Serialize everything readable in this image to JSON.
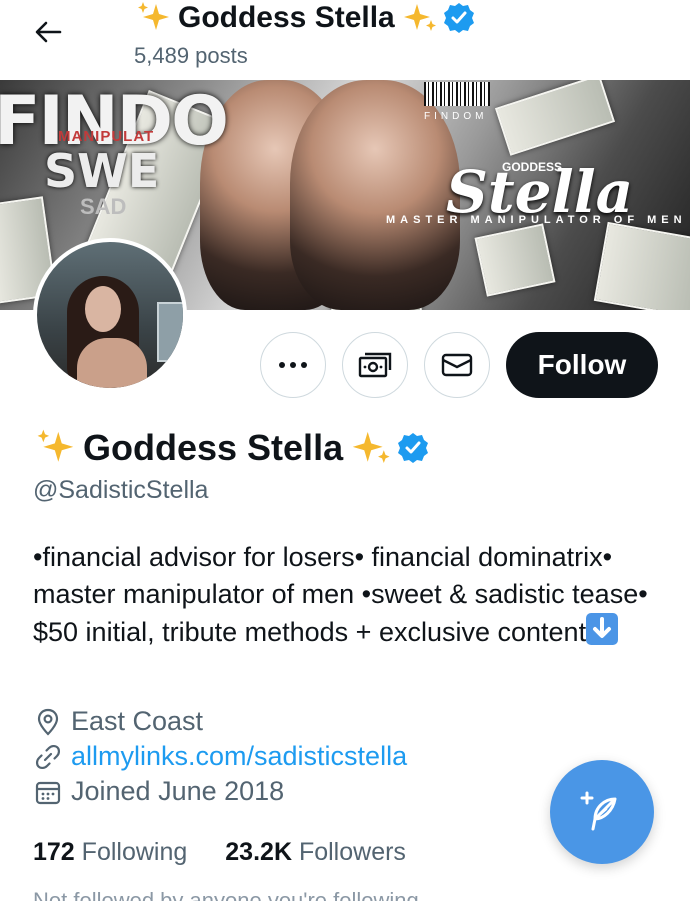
{
  "header": {
    "display_name": "Goddess Stella",
    "posts_count": "5,489 posts"
  },
  "banner": {
    "text_findo": "FINDO",
    "text_manipulat": "MANIPULAT",
    "text_swe": "SWE",
    "text_sad": "SAD",
    "text_findom": "FINDOM",
    "text_goddess": "GODDESS",
    "text_stella": "Stella",
    "text_tagline": "MASTER MANIPULATOR OF MEN"
  },
  "actions": {
    "follow_label": "Follow",
    "more_icon": "more-horizontal-icon",
    "tip_icon": "money-icon",
    "message_icon": "envelope-icon"
  },
  "profile": {
    "display_name": "Goddess Stella",
    "handle": "@SadisticStella",
    "bio": "•financial advisor for losers• financial dominatrix• master manipulator of men •sweet & sadistic tease• $50 initial, tribute methods + exclusive content",
    "location": "East Coast",
    "website": "allmylinks.com/sadisticstella",
    "joined": "Joined June 2018"
  },
  "stats": {
    "following_count": "172",
    "following_label": "Following",
    "followers_count": "23.2K",
    "followers_label": "Followers"
  },
  "footer_cutoff": "Not followed by anyone you're following",
  "colors": {
    "accent": "#1d9bf0",
    "fab": "#4a96e6",
    "verified": "#1d9bf0",
    "sparkle": "#f5b82e",
    "follow_bg": "#0f1419"
  }
}
